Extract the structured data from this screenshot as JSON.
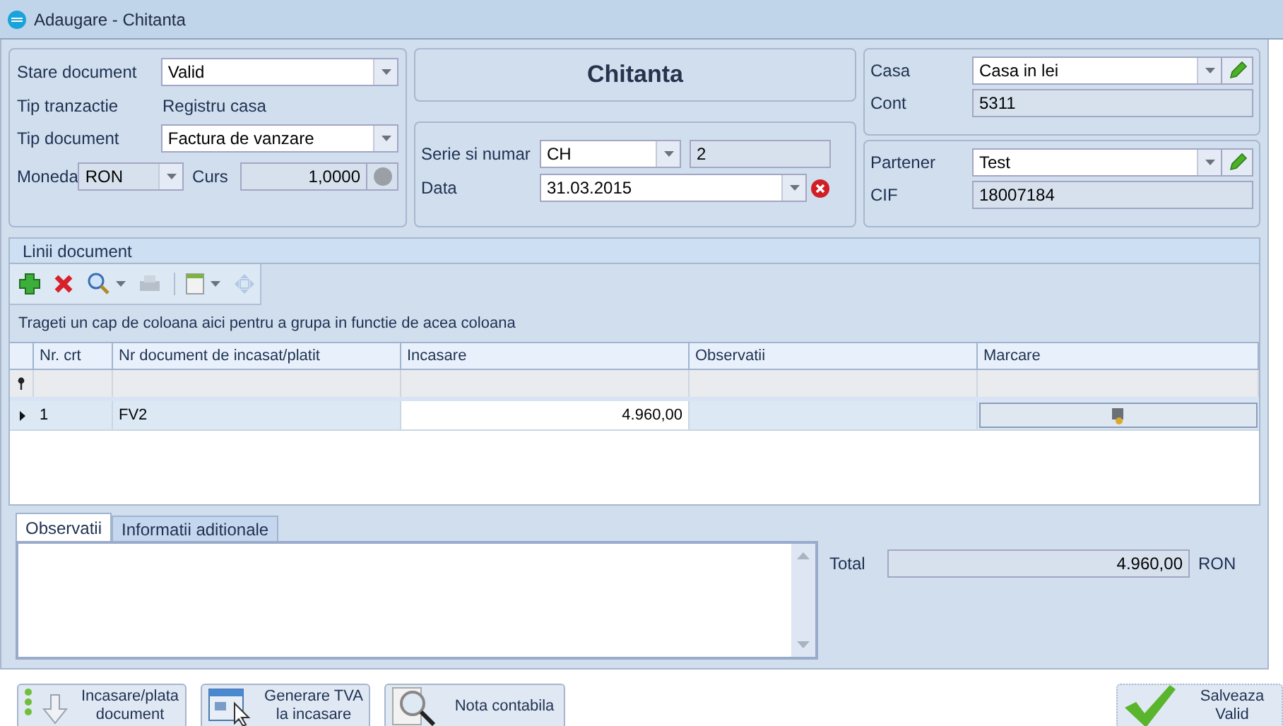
{
  "window": {
    "title": "Adaugare - Chitanta"
  },
  "header": {
    "stare": {
      "label": "Stare document",
      "value": "Valid"
    },
    "tranzactie": {
      "label": "Tip tranzactie",
      "value": "Registru casa"
    },
    "tip": {
      "label": "Tip document",
      "value": "Factura de vanzare"
    },
    "moneda": {
      "label": "Moneda",
      "value": "RON",
      "disabled": true
    },
    "curs": {
      "label": "Curs",
      "value": "1,0000"
    }
  },
  "doc_title": "Chitanta",
  "serie": {
    "label": "Serie si numar",
    "series": "CH",
    "number": "2"
  },
  "data": {
    "label": "Data",
    "value": "31.03.2015"
  },
  "casa": {
    "label": "Casa",
    "value": "Casa in lei"
  },
  "cont": {
    "label": "Cont",
    "value": "5311"
  },
  "partener": {
    "label": "Partener",
    "value": "Test"
  },
  "cif": {
    "label": "CIF",
    "value": "18007184"
  },
  "lines": {
    "title": "Linii document",
    "toolbar": [
      {
        "kind": "add",
        "disabled": false
      },
      {
        "kind": "delete",
        "disabled": false
      },
      {
        "kind": "search",
        "disabled": false
      },
      {
        "kind": "print",
        "disabled": true
      },
      {
        "kind": "export",
        "disabled": false
      },
      {
        "kind": "move",
        "disabled": true
      }
    ],
    "group_hint": "Trageti un cap de coloana aici pentru a grupa in functie de acea coloana",
    "columns": [
      "Nr. crt",
      "Nr document de incasat/platit",
      "Incasare",
      "Observatii",
      "Marcare"
    ],
    "rows": [
      {
        "selected": true,
        "cells": [
          "1",
          "FV2",
          "4.960,00",
          ""
        ]
      }
    ]
  },
  "tabs": [
    {
      "label": "Observatii",
      "selected": true
    },
    {
      "label": "Informatii aditionale",
      "selected": false
    }
  ],
  "total": {
    "label": "Total",
    "value": "4.960,00",
    "currency": "RON"
  },
  "buttons": [
    {
      "kind": "import",
      "lines": [
        "Incasare/plata",
        "document"
      ]
    },
    {
      "kind": "vat",
      "lines": [
        "Generare TVA",
        "la incasare"
      ]
    },
    {
      "kind": "ledger",
      "lines": [
        "Nota contabila"
      ]
    },
    {
      "kind": "save",
      "lines": [
        "Salveaza",
        "Valid"
      ]
    }
  ]
}
